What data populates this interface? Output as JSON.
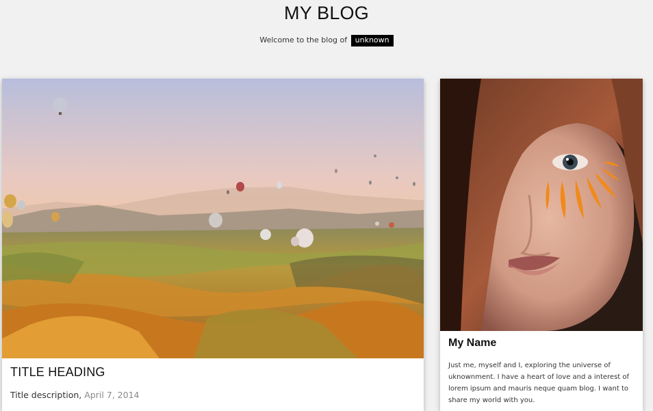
{
  "header": {
    "title": "MY BLOG",
    "welcome_text": "Welcome to the blog of",
    "username": "unknown"
  },
  "post": {
    "image_alt": "hot air balloons over valley",
    "title": "TITLE HEADING",
    "description": "Title description,",
    "date": "April 7, 2014"
  },
  "profile": {
    "image_alt": "portrait of woman with orange petals",
    "name": "My Name",
    "bio": "Just me, myself and I, exploring the universe of uknownment. I have a heart of love and a interest of lorem ipsum and mauris neque quam blog. I want to share my world with you."
  },
  "colors": {
    "background": "#f1f1f1",
    "card": "#ffffff",
    "tag_bg": "#000000",
    "date": "#888888"
  }
}
